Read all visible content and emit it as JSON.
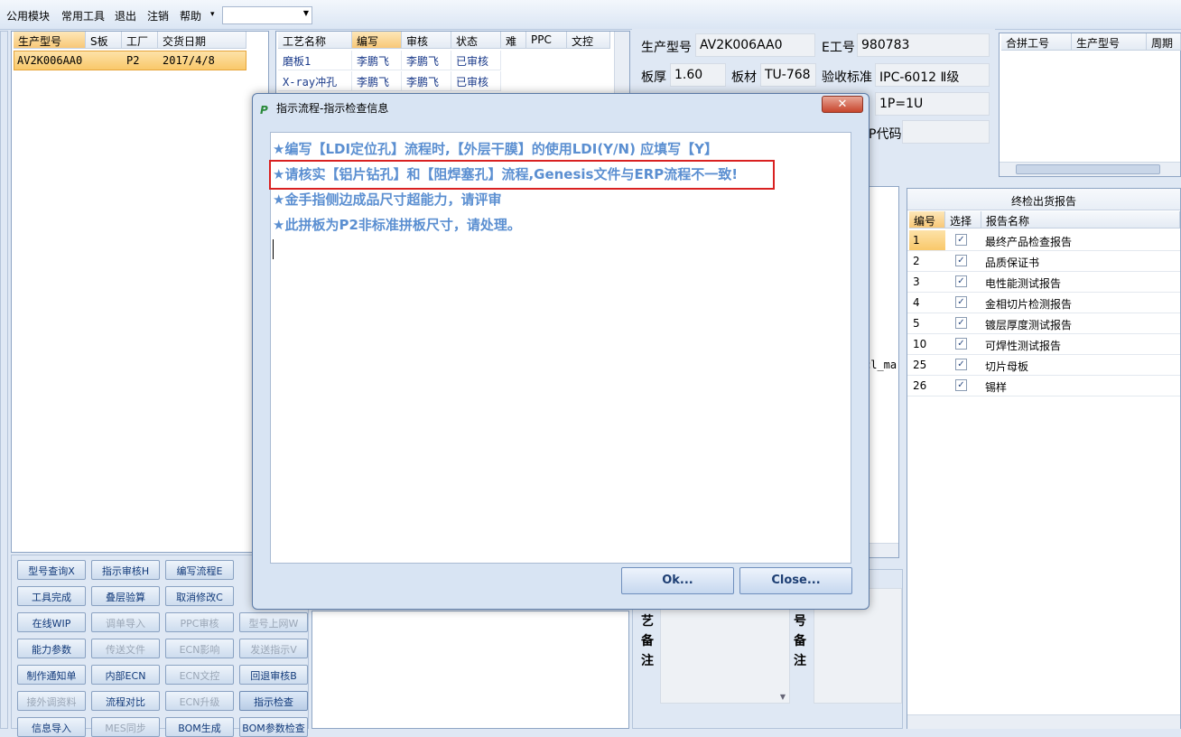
{
  "menu": {
    "items": [
      "公用模块",
      "常用工具",
      "退出",
      "注销",
      "帮助"
    ],
    "help_arrow": "▾",
    "combo_value": ""
  },
  "left_grid": {
    "headers": [
      "生产型号",
      "S板",
      "工厂",
      "交货日期"
    ],
    "row": {
      "model": "AV2K006AA0",
      "factory": "P2",
      "date": "2017/4/8"
    }
  },
  "process_grid": {
    "headers": [
      "工艺名称",
      "编写",
      "审核",
      "状态",
      "难",
      "PPC",
      "文控"
    ],
    "rows": [
      {
        "name": "磨板1",
        "writer": "李鹏飞",
        "auditor": "李鹏飞",
        "status": "已审核"
      },
      {
        "name": "X-ray冲孔",
        "writer": "李鹏飞",
        "auditor": "李鹏飞",
        "status": "已审核"
      }
    ]
  },
  "info": {
    "model_label": "生产型号",
    "model_value": "AV2K006AA0",
    "e_label": "E工号",
    "e_value": "980783",
    "thick_label": "板厚",
    "thick_value": "1.60",
    "mat_label": "板材",
    "mat_value": "TU-768",
    "std_label": "验收标准",
    "std_value": "IPC-6012 Ⅱ级",
    "unit_value": "1P=1U",
    "code_label": "P代码"
  },
  "combine_grid": {
    "headers": [
      "合拼工号",
      "生产型号",
      "周期"
    ]
  },
  "report": {
    "title": "终检出货报告",
    "headers": [
      "编号",
      "选择",
      "报告名称"
    ],
    "rows": [
      {
        "no": "1",
        "name": "最终产品检查报告"
      },
      {
        "no": "2",
        "name": "品质保证书"
      },
      {
        "no": "3",
        "name": "电性能测试报告"
      },
      {
        "no": "4",
        "name": "金相切片检测报告"
      },
      {
        "no": "5",
        "name": "镀层厚度测试报告"
      },
      {
        "no": "10",
        "name": "可焊性测试报告"
      },
      {
        "no": "25",
        "name": "切片母板"
      },
      {
        "no": "26",
        "name": "锡样"
      }
    ],
    "check_glyph": "✓"
  },
  "middle_fragment": "cl_ma",
  "remarks": {
    "left": "艺备注",
    "right": "号备注"
  },
  "buttons": [
    "型号查询X",
    "指示审核H",
    "编写流程E",
    "工具完成",
    "叠层验算",
    "取消修改C",
    "在线WIP",
    "调单导入",
    "PPC审核",
    "型号上网W",
    "能力参数",
    "传送文件",
    "ECN影响",
    "发送指示V",
    "制作通知单",
    "内部ECN",
    "ECN文控",
    "回退审核B",
    "接外调资料",
    "流程对比",
    "ECN升级",
    "指示检查",
    "信息导入",
    "MES同步",
    "BOM生成",
    "BOM参数检查"
  ],
  "modal": {
    "title": "指示流程-指示检查信息",
    "close_glyph": "✕",
    "messages": [
      "★编写【LDI定位孔】流程时,【外层干膜】的使用LDI(Y/N) 应填写【Y】",
      "★请核实【铝片钻孔】和【阻焊塞孔】流程,Genesis文件与ERP流程不一致!",
      "★金手指侧边成品尺寸超能力，请评审",
      "★此拼板为P2非标准拼板尺寸，请处理。"
    ],
    "ok_label": "Ok...",
    "close_label": "Close..."
  }
}
